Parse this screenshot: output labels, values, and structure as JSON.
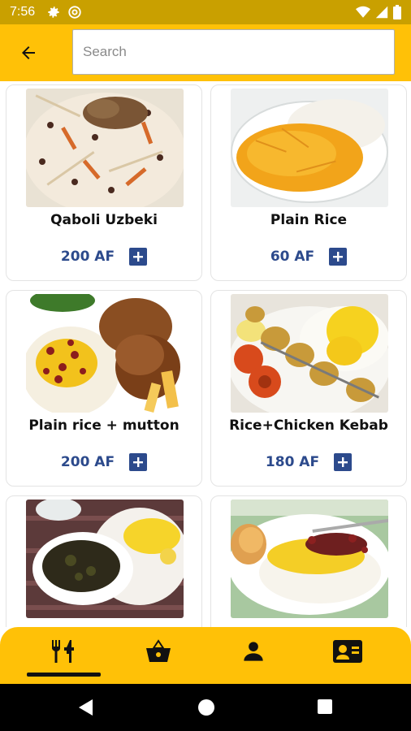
{
  "status_bar": {
    "time": "7:56",
    "icons": [
      "gear-icon",
      "at-icon",
      "wifi-icon",
      "signal-icon",
      "battery-icon"
    ]
  },
  "header": {
    "back_icon": "arrow-left-icon",
    "search_placeholder": "Search",
    "search_value": ""
  },
  "items": [
    {
      "name": "Qaboli Uzbeki",
      "price": "200 AF"
    },
    {
      "name": "Plain Rice",
      "price": "60 AF"
    },
    {
      "name": "Plain rice + mutton",
      "price": "200 AF"
    },
    {
      "name": "Rice+Chicken Kebab",
      "price": "180 AF"
    },
    {
      "name": "",
      "price": ""
    },
    {
      "name": "",
      "price": ""
    }
  ],
  "bottom_nav": {
    "items": [
      {
        "icon": "restaurant-icon",
        "active": true
      },
      {
        "icon": "basket-icon",
        "active": false
      },
      {
        "icon": "person-icon",
        "active": false
      },
      {
        "icon": "contact-card-icon",
        "active": false
      }
    ]
  },
  "colors": {
    "accent": "#ffc107",
    "status_bar": "#c9a000",
    "price": "#2c4a8c"
  }
}
